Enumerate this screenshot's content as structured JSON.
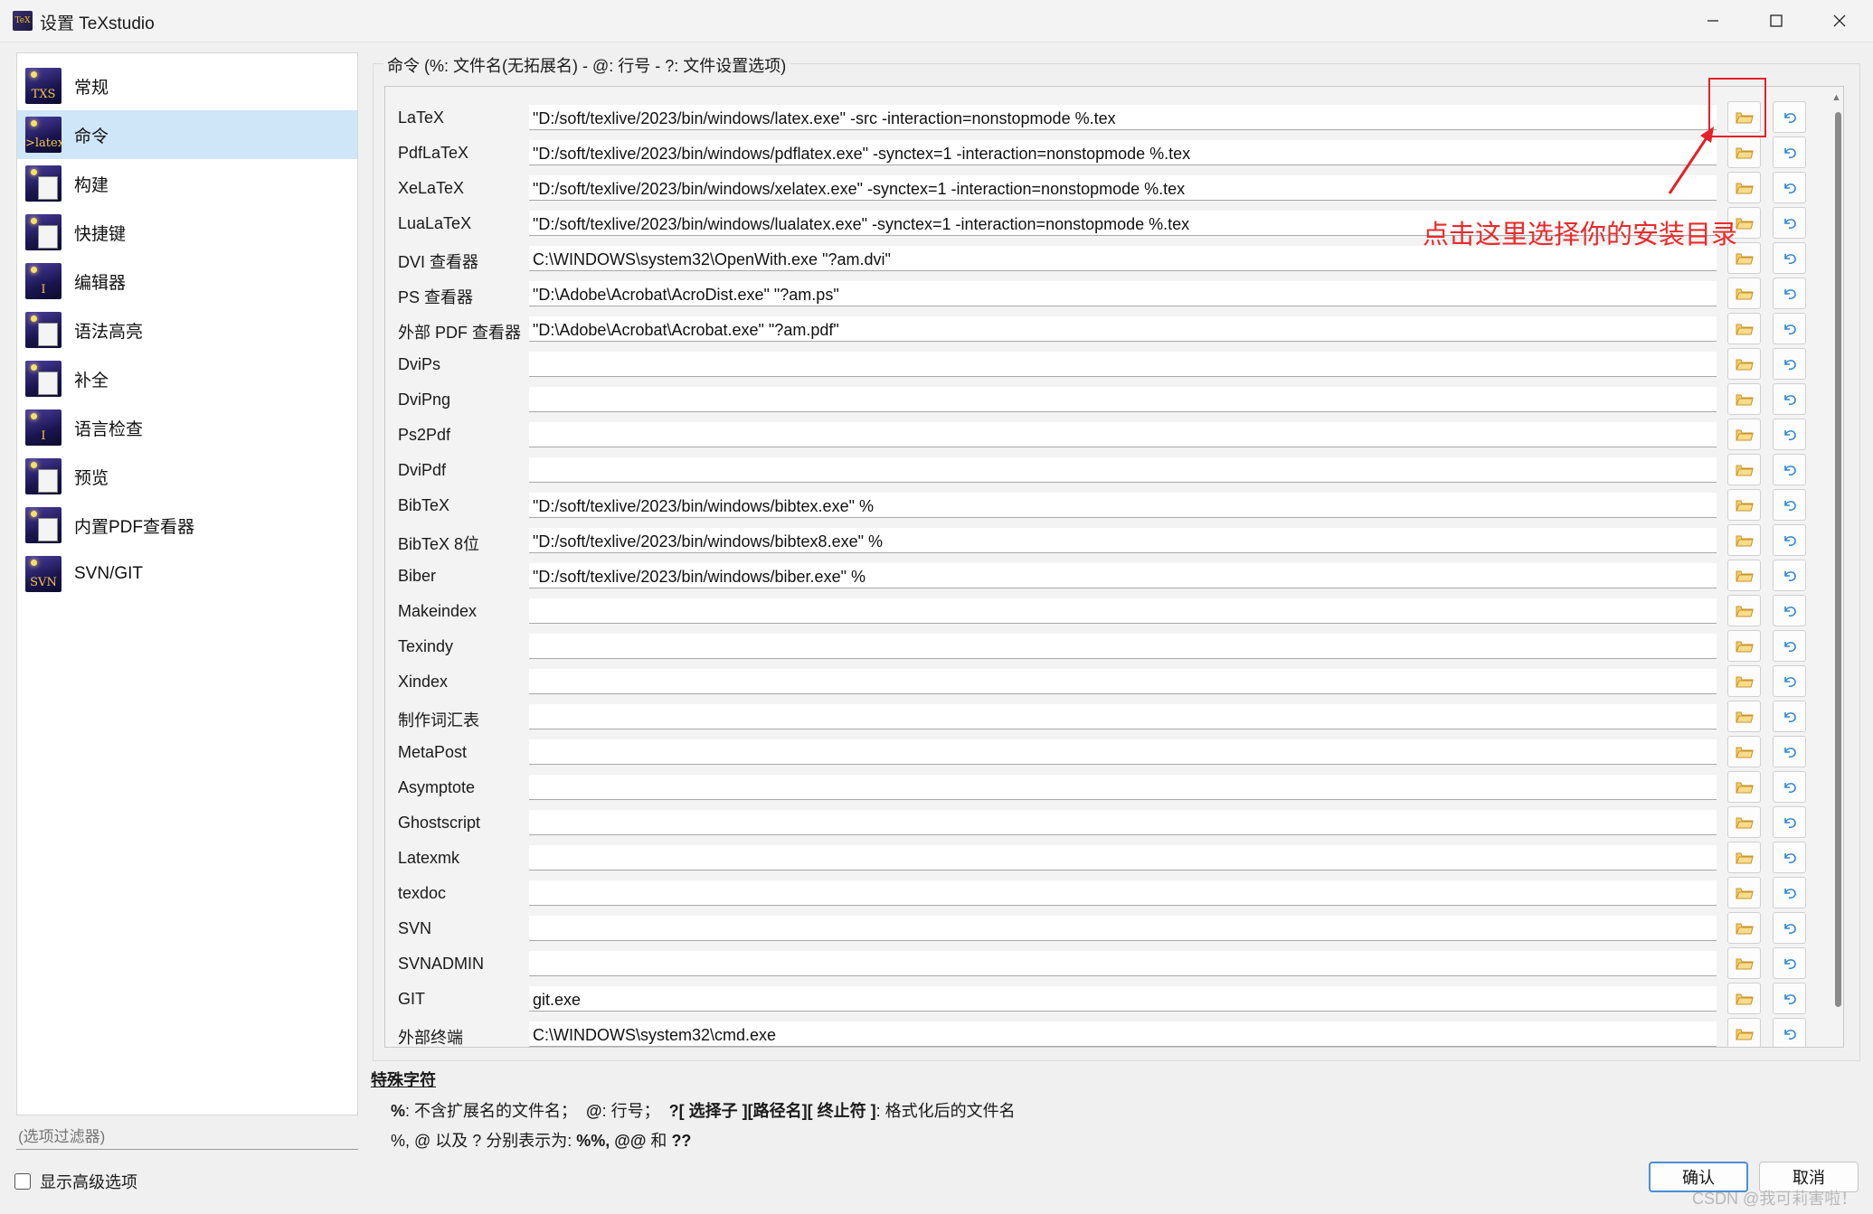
{
  "window": {
    "title": "设置 TeXstudio",
    "icon_text": "TeX"
  },
  "sidebar": {
    "items": [
      {
        "label": "常规",
        "icon": "txs-general-icon",
        "glyph": "TXS"
      },
      {
        "label": "命令",
        "icon": "latex-command-icon",
        "glyph": ">latex"
      },
      {
        "label": "构建",
        "icon": "build-icon",
        "glyph": ""
      },
      {
        "label": "快捷键",
        "icon": "keyboard-shortcut-icon",
        "glyph": ""
      },
      {
        "label": "编辑器",
        "icon": "editor-cursor-icon",
        "glyph": "I"
      },
      {
        "label": "语法高亮",
        "icon": "syntax-highlight-icon",
        "glyph": ""
      },
      {
        "label": "补全",
        "icon": "completion-icon",
        "glyph": ""
      },
      {
        "label": "语言检查",
        "icon": "language-check-icon",
        "glyph": "I"
      },
      {
        "label": "预览",
        "icon": "preview-icon",
        "glyph": ""
      },
      {
        "label": "内置PDF查看器",
        "icon": "pdf-viewer-icon",
        "glyph": ""
      },
      {
        "label": "SVN/GIT",
        "icon": "svn-git-icon",
        "glyph": "SVN"
      }
    ],
    "selected_index": 1,
    "filter_placeholder": "(选项过滤器)",
    "advanced_label": "显示高级选项"
  },
  "commands": {
    "group_title": "命令 (%: 文件名(无拓展名) - @: 行号 - ?: 文件设置选项)",
    "rows": [
      {
        "label": "LaTeX",
        "value": "\"D:/soft/texlive/2023/bin/windows/latex.exe\" -src -interaction=nonstopmode %.tex"
      },
      {
        "label": "PdfLaTeX",
        "value": "\"D:/soft/texlive/2023/bin/windows/pdflatex.exe\" -synctex=1 -interaction=nonstopmode %.tex"
      },
      {
        "label": "XeLaTeX",
        "value": "\"D:/soft/texlive/2023/bin/windows/xelatex.exe\" -synctex=1 -interaction=nonstopmode %.tex"
      },
      {
        "label": "LuaLaTeX",
        "value": "\"D:/soft/texlive/2023/bin/windows/lualatex.exe\" -synctex=1 -interaction=nonstopmode %.tex"
      },
      {
        "label": "DVI 查看器",
        "value": "C:\\WINDOWS\\system32\\OpenWith.exe \"?am.dvi\""
      },
      {
        "label": "PS 查看器",
        "value": "\"D:\\Adobe\\Acrobat\\AcroDist.exe\" \"?am.ps\""
      },
      {
        "label": "外部 PDF 查看器",
        "value": "\"D:\\Adobe\\Acrobat\\Acrobat.exe\" \"?am.pdf\""
      },
      {
        "label": "DviPs",
        "value": ""
      },
      {
        "label": "DviPng",
        "value": ""
      },
      {
        "label": "Ps2Pdf",
        "value": ""
      },
      {
        "label": "DviPdf",
        "value": ""
      },
      {
        "label": "BibTeX",
        "value": "\"D:/soft/texlive/2023/bin/windows/bibtex.exe\" %"
      },
      {
        "label": "BibTeX 8位",
        "value": "\"D:/soft/texlive/2023/bin/windows/bibtex8.exe\" %"
      },
      {
        "label": "Biber",
        "value": "\"D:/soft/texlive/2023/bin/windows/biber.exe\" %"
      },
      {
        "label": "Makeindex",
        "value": ""
      },
      {
        "label": "Texindy",
        "value": ""
      },
      {
        "label": "Xindex",
        "value": ""
      },
      {
        "label": "制作词汇表",
        "value": ""
      },
      {
        "label": "MetaPost",
        "value": ""
      },
      {
        "label": "Asymptote",
        "value": ""
      },
      {
        "label": "Ghostscript",
        "value": ""
      },
      {
        "label": "Latexmk",
        "value": ""
      },
      {
        "label": "texdoc",
        "value": ""
      },
      {
        "label": "SVN",
        "value": ""
      },
      {
        "label": "SVNADMIN",
        "value": ""
      },
      {
        "label": "GIT",
        "value": "git.exe"
      },
      {
        "label": "外部终端",
        "value": "C:\\WINDOWS\\system32\\cmd.exe"
      }
    ],
    "browse_icon": "folder-open-icon",
    "reset_icon": "undo-arrow-icon"
  },
  "annotation": {
    "text": "点击这里选择你的安装目录",
    "color": "#e5202a"
  },
  "special": {
    "title": "特殊字符",
    "line1_a": "%",
    "line1_b": ": 不含扩展名的文件名；",
    "line1_c": "@",
    "line1_d": ": 行号；",
    "line1_e": "?[ 选择子 ][路径名][ 终止符 ]",
    "line1_f": ": 格式化后的文件名",
    "line2_a": "%, @ 以及 ? 分别表示为: ",
    "line2_b": "%%, @@",
    "line2_c": " 和 ",
    "line2_d": "??"
  },
  "buttons": {
    "ok": "确认",
    "cancel": "取消"
  },
  "watermark": "CSDN @我可莉害啦！",
  "colors": {
    "selected_bg": "#cfe5f8",
    "folder": "#e8b84a",
    "reset_arrow": "#2f86d6"
  }
}
